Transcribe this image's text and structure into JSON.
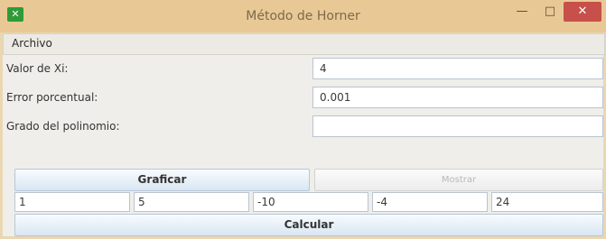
{
  "window": {
    "title": "Método de Horner",
    "icon": "java-icon",
    "controls": [
      "minimize",
      "maximize",
      "close"
    ]
  },
  "menu": {
    "archivo": "Archivo"
  },
  "form": {
    "xi_label": "Valor de Xi:",
    "xi_value": "4",
    "error_label": "Error porcentual:",
    "error_value": "0.001",
    "grado_label": "Grado del polinomio:",
    "grado_value": ""
  },
  "buttons": {
    "graficar": "Graficar",
    "second": "Mostrar",
    "calcular": "Calcular"
  },
  "coefficients": [
    "1",
    "5",
    "-10",
    "-4",
    "24"
  ],
  "colors": {
    "titlebar": "#e8c996",
    "close_button": "#c7504a",
    "panel": "#efeeea",
    "button_border": "#b6c7d8"
  }
}
